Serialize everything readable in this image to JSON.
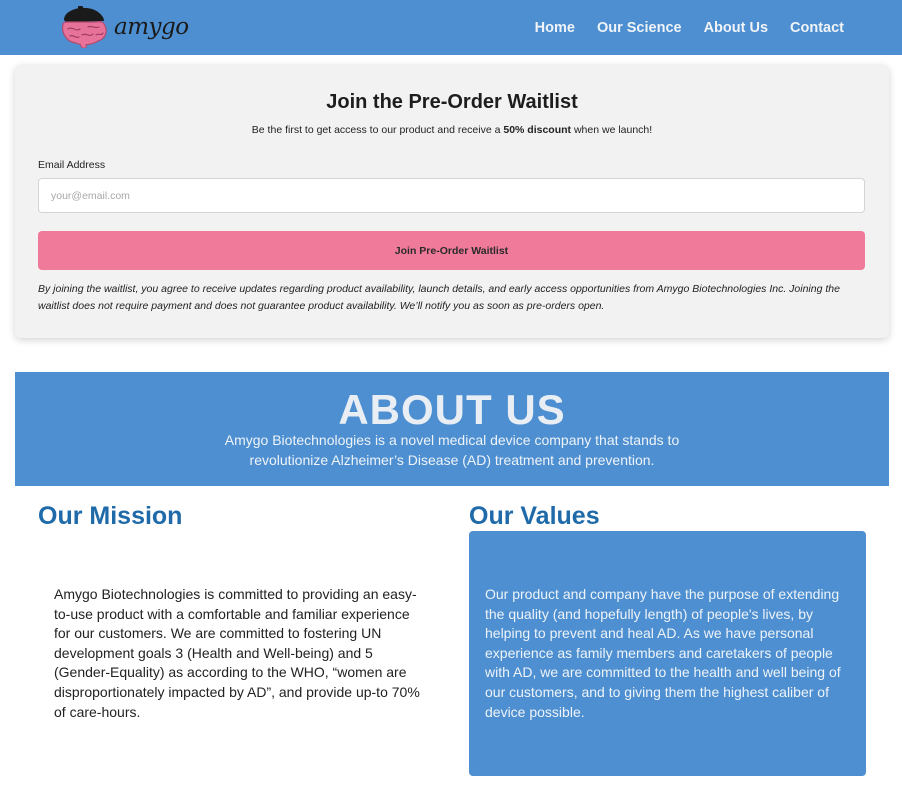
{
  "header": {
    "brand": "amygo",
    "logo_icon": "brain-with-cap-icon",
    "nav": [
      {
        "label": "Home"
      },
      {
        "label": "Our Science"
      },
      {
        "label": "About Us"
      },
      {
        "label": "Contact"
      }
    ]
  },
  "waitlist": {
    "title": "Join the Pre-Order Waitlist",
    "subtitle_before": "Be the first to get access to our product and receive a ",
    "subtitle_bold": "50% discount",
    "subtitle_after": " when we launch!",
    "email_label": "Email Address",
    "email_placeholder": "your@email.com",
    "email_value": "",
    "button_label": "Join Pre-Order Waitlist",
    "disclaimer": "By joining the waitlist, you agree to receive updates regarding product availability, launch details, and early access opportunities from Amygo Biotechnologies Inc. Joining the waitlist does not require payment and does not guarantee product availability. We’ll notify you as soon as pre-orders open."
  },
  "about": {
    "title": "ABOUT US",
    "text": "Amygo Biotechnologies is a novel medical device company that stands to revolutionize Alzheimer’s Disease (AD) treatment and prevention."
  },
  "mission": {
    "title": "Our Mission",
    "text": "Amygo Biotechnologies is committed to providing an easy-to-use product with a comfortable and familiar experience for our customers. We are committed to fostering UN development goals 3 (Health and Well-being) and 5 (Gender-Equality) as according to the WHO, “women are disproportionately impacted by AD”, and provide up-to 70% of care-hours."
  },
  "values": {
    "title": "Our Values",
    "text": "Our product and company have the purpose of extending the quality (and hopefully length) of people's lives, by helping to prevent and heal AD. As we have personal experience as family members and caretakers of people with AD, we are committed to the health and well being of our customers, and to giving them the highest caliber of device possible."
  },
  "colors": {
    "primary_blue": "#4d8fd0",
    "accent_pink": "#ef7a9a",
    "heading_blue": "#1f6aa8",
    "card_bg": "#f2f2f2"
  }
}
